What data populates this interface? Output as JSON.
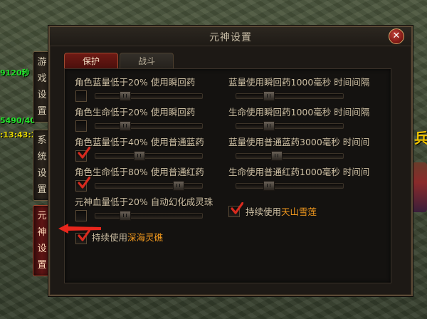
{
  "hud": {
    "line1": "9120秒",
    "line2": "5490/40",
    "line3": ":13:43:2"
  },
  "npc_glyph": "兵",
  "side_tabs": [
    {
      "label": [
        "游",
        "戏",
        "设",
        "置"
      ],
      "active": false
    },
    {
      "label": [
        "系",
        "统",
        "设",
        "置"
      ],
      "active": false
    },
    {
      "label": [
        "元",
        "神",
        "设",
        "置"
      ],
      "active": true
    }
  ],
  "dialog": {
    "title": "元神设置",
    "close_label": "✕",
    "tabs": [
      {
        "label": "保护",
        "active": true
      },
      {
        "label": "战斗",
        "active": false
      }
    ],
    "rows": [
      {
        "label": "角色蓝量低于20% 使用瞬回药",
        "checked": false,
        "slider": 0.25,
        "right_label": "蓝量使用瞬回药1000毫秒 时间间隔",
        "right_slider": 0.28
      },
      {
        "label": "角色生命低于20% 使用瞬回药",
        "checked": false,
        "slider": 0.25,
        "right_label": "生命使用瞬回药1000毫秒 时间间隔",
        "right_slider": 0.28
      },
      {
        "label": "角色蓝量低于40% 使用普通蓝药",
        "checked": true,
        "slider": 0.4,
        "right_label": "蓝量使用普通蓝药3000毫秒 时间间",
        "right_slider": 0.36
      },
      {
        "label": "角色生命低于80% 使用普通红药",
        "checked": true,
        "slider": 0.8,
        "right_label": "生命使用普通红药1000毫秒 时间间",
        "right_slider": 0.28
      },
      {
        "label": "元神血量低于20% 自动幻化成灵珠",
        "checked": false,
        "slider": 0.25
      }
    ],
    "extra_right": {
      "prefix": "持续使用",
      "item": "天山雪莲",
      "checked": true
    },
    "extra_left": {
      "prefix": "持续使用",
      "item": "深海灵礁",
      "checked": true
    }
  },
  "colors": {
    "accent_orange": "#f49a1e",
    "check_red": "#d82a1e",
    "arrow_red": "#e8261c"
  }
}
